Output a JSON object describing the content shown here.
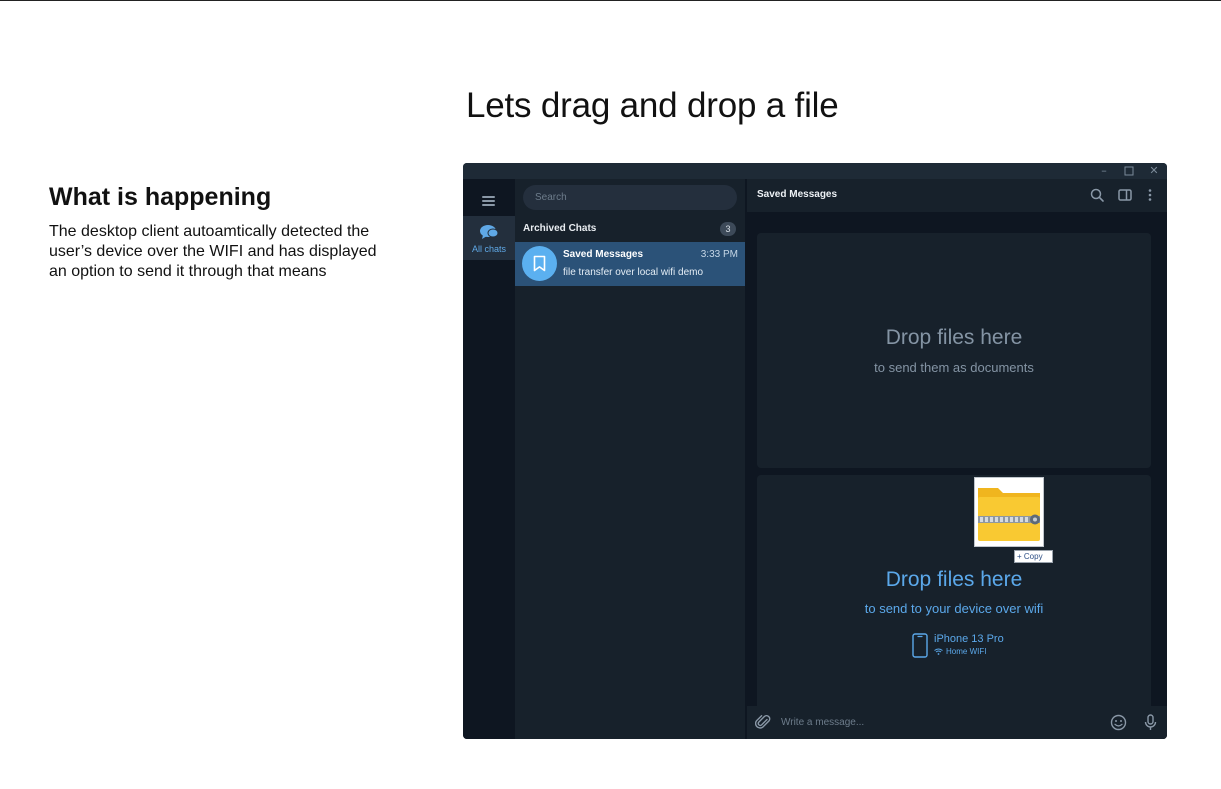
{
  "slide": {
    "title": "Lets drag and drop a file",
    "explanation_heading": "What is happening",
    "explanation_body": "The desktop client autoamtically detected the user’s device over the WIFI and has displayed an option to send it through that means"
  },
  "window_controls": [
    "minimize-icon",
    "maximize-icon",
    "close-icon"
  ],
  "sidebar": {
    "menu_icon": "hamburger-menu-icon",
    "folders": [
      {
        "label": "All chats",
        "icon": "chat-bubbles-icon",
        "active": true
      }
    ]
  },
  "chat_list": {
    "search_placeholder": "Search",
    "archived_label": "Archived Chats",
    "archived_count": "3",
    "chats": [
      {
        "name": "Saved Messages",
        "time": "3:33 PM",
        "preview": "file transfer over local wifi demo",
        "avatar_icon": "bookmark-icon",
        "selected": true
      }
    ]
  },
  "chat": {
    "title": "Saved Messages",
    "header_icons": [
      "search-icon",
      "sidebar-toggle-icon",
      "more-vertical-icon"
    ],
    "drop_zone_documents": {
      "title": "Drop files here",
      "subtitle": "to send them as documents"
    },
    "drop_zone_wifi": {
      "title": "Drop files here",
      "subtitle": "to send to your device over wifi",
      "device_name": "iPhone 13 Pro",
      "network_name": "Home WIFI"
    },
    "dragged_file": {
      "icon": "zip-folder-icon",
      "tooltip": "Copy"
    },
    "composer": {
      "placeholder": "Write a message...",
      "icons": [
        "attach-icon",
        "emoji-icon",
        "microphone-icon"
      ]
    }
  },
  "colors": {
    "window_bg": "#17212b",
    "rail_bg": "#0e1621",
    "selected_row": "#2b5278",
    "accent": "#5ba8ea",
    "folder_yellow": "#f9c932"
  }
}
